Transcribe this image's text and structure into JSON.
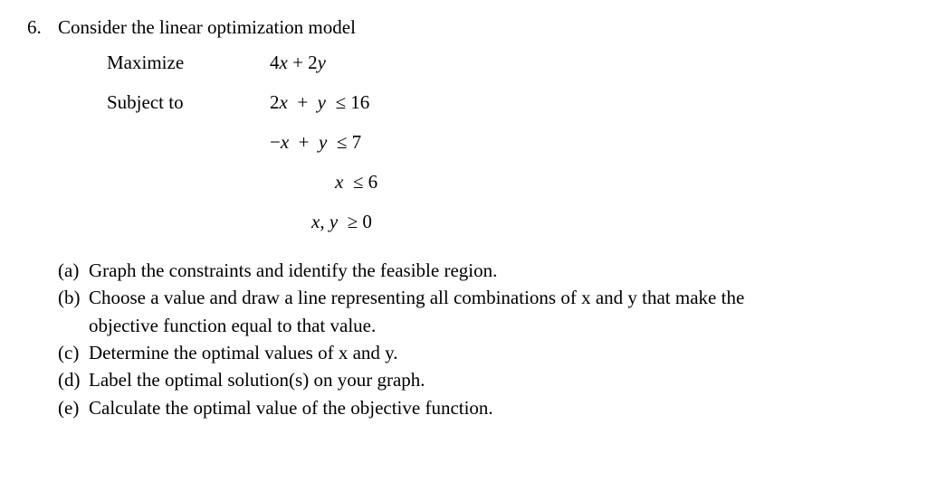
{
  "problem": {
    "number": "6.",
    "intro": "Consider the linear optimization model",
    "model": {
      "maximize_label": "Maximize",
      "objective": "4x + 2y",
      "subject_label": "Subject to",
      "constraints": [
        "2x  +  y  ≤ 16",
        "−x  +  y  ≤ 7",
        "x  ≤ 6",
        "x, y  ≥ 0"
      ]
    },
    "parts": [
      {
        "label": "(a)",
        "text": "Graph the constraints and identify the feasible region."
      },
      {
        "label": "(b)",
        "text": "Choose a value and draw a line representing all combinations of x and y that make the",
        "cont": "objective function equal to that value."
      },
      {
        "label": "(c)",
        "text": "Determine the optimal values of x and y."
      },
      {
        "label": "(d)",
        "text": "Label the optimal solution(s) on your graph."
      },
      {
        "label": "(e)",
        "text": "Calculate the optimal value of the objective function."
      }
    ]
  }
}
